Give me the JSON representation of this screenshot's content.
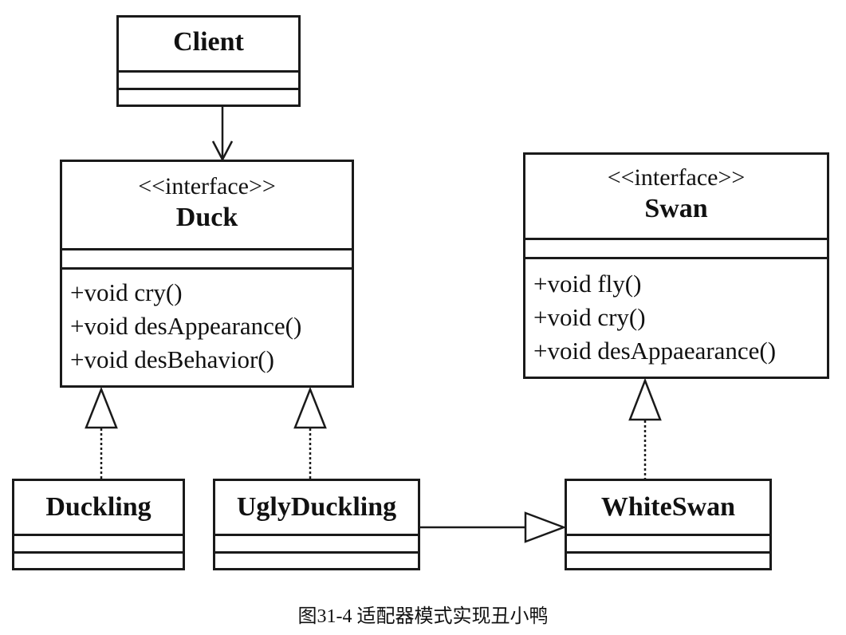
{
  "classes": {
    "client": {
      "name": "Client"
    },
    "duck": {
      "stereotype": "<<interface>>",
      "name": "Duck",
      "operations": [
        "+void cry()",
        "+void desAppearance()",
        "+void desBehavior()"
      ]
    },
    "swan": {
      "stereotype": "<<interface>>",
      "name": "Swan",
      "operations": [
        "+void fly()",
        "+void cry()",
        "+void desAppaearance()"
      ]
    },
    "duckling": {
      "name": "Duckling"
    },
    "ugly_duckling": {
      "name": "UglyDuckling"
    },
    "white_swan": {
      "name": "WhiteSwan"
    }
  },
  "caption": "图31-4 适配器模式实现丑小鸭"
}
